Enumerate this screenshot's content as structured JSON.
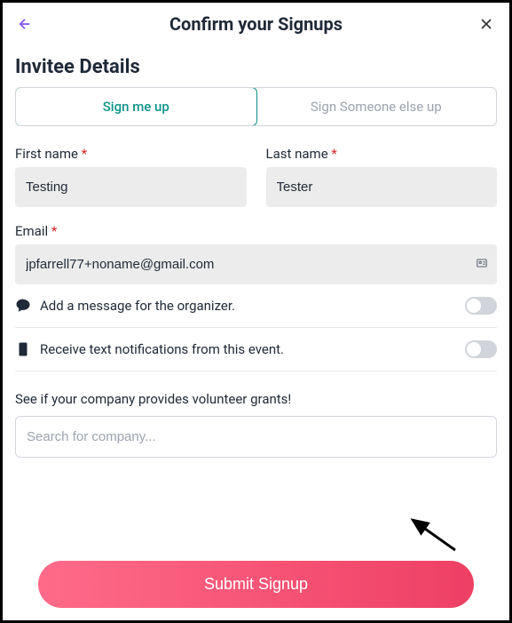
{
  "header": {
    "title": "Confirm your Signups"
  },
  "section": {
    "title": "Invitee Details"
  },
  "tabs": {
    "signMe": "Sign me up",
    "signElse": "Sign Someone else up"
  },
  "fields": {
    "firstName": {
      "label": "First name",
      "value": "Testing"
    },
    "lastName": {
      "label": "Last name",
      "value": "Tester"
    },
    "email": {
      "label": "Email",
      "value": "jpfarrell77+noname@gmail.com"
    }
  },
  "options": {
    "message": "Add a message for the organizer.",
    "sms": "Receive text notifications from this event."
  },
  "grants": {
    "label": "See if your company provides volunteer grants!",
    "placeholder": "Search for company..."
  },
  "submit": {
    "label": "Submit Signup"
  },
  "required": "*"
}
